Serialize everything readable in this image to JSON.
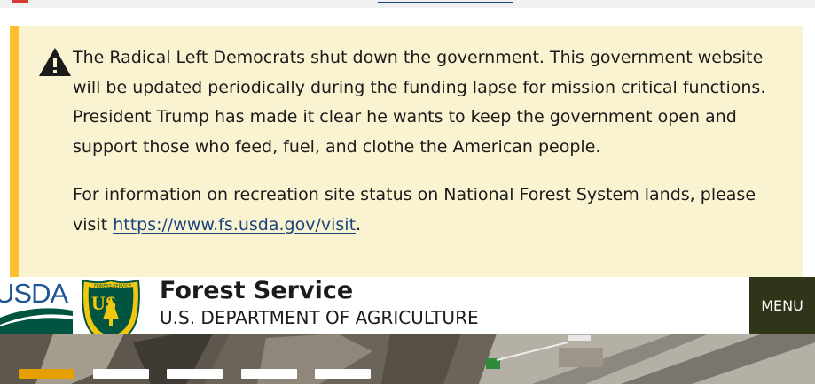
{
  "alert": {
    "icon": "warning-icon",
    "paragraph1": "The Radical Left Democrats shut down the government. This government website will be updated periodically during the funding lapse for mission critical functions. President Trump has made it clear he wants to keep the government open and support those who feed, fuel, and clothe the American people.",
    "paragraph2_prefix": "For information on recreation site status on National Forest System lands, please visit ",
    "link_text": "https://www.fs.usda.gov/visit",
    "paragraph2_suffix": ".",
    "colors": {
      "background": "#faf3d1",
      "accent": "#ffbe2e"
    }
  },
  "header": {
    "usda_logo_text": "USDA",
    "shield_text": "US",
    "shield_ring_top": "FOREST SERVICE",
    "shield_ring_bottom": "DEPARTMENT OF AGRICULTURE",
    "title": "Forest Service",
    "subtitle": "U.S. DEPARTMENT OF AGRICULTURE",
    "menu_label": "MENU",
    "colors": {
      "menu_bg": "#2e3518",
      "usda_green": "#005440",
      "usda_blue": "#205493"
    }
  },
  "carousel": {
    "slide_count": 5,
    "active_index": 0,
    "colors": {
      "active": "#e5a000",
      "inactive": "#ffffff"
    }
  }
}
